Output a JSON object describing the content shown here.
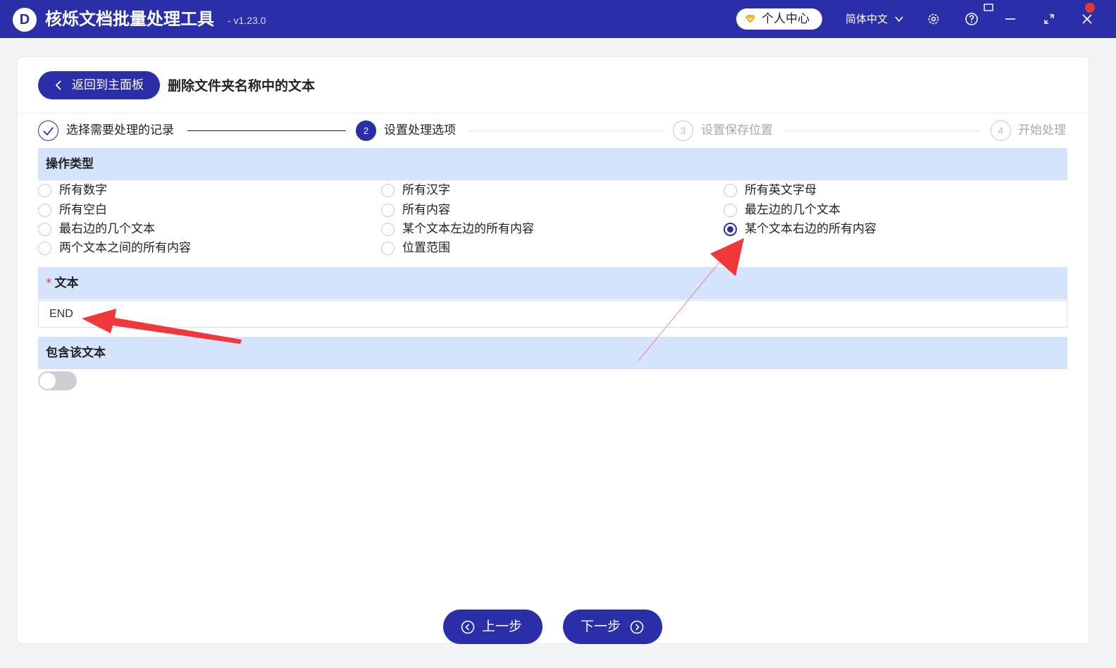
{
  "titlebar": {
    "logo_letter": "D",
    "title": "核烁文档批量处理工具",
    "version": "- v1.23.0",
    "user_center": "个人中心",
    "language": "简体中文",
    "icons": [
      "settings-icon",
      "help-icon",
      "minimize-icon",
      "maximize-icon",
      "close-icon"
    ]
  },
  "header": {
    "back_button": "返回到主面板",
    "page_title": "删除文件夹名称中的文本"
  },
  "steps": [
    {
      "number": "",
      "label": "选择需要处理的记录",
      "state": "done"
    },
    {
      "number": "2",
      "label": "设置处理选项",
      "state": "active"
    },
    {
      "number": "3",
      "label": "设置保存位置",
      "state": "pending"
    },
    {
      "number": "4",
      "label": "开始处理",
      "state": "pending"
    }
  ],
  "operation": {
    "title": "操作类型",
    "options": [
      {
        "label": "所有数字",
        "checked": false
      },
      {
        "label": "所有汉字",
        "checked": false
      },
      {
        "label": "所有英文字母",
        "checked": false
      },
      {
        "label": "所有空白",
        "checked": false
      },
      {
        "label": "所有内容",
        "checked": false
      },
      {
        "label": "最左边的几个文本",
        "checked": false
      },
      {
        "label": "最右边的几个文本",
        "checked": false
      },
      {
        "label": "某个文本左边的所有内容",
        "checked": false
      },
      {
        "label": "某个文本右边的所有内容",
        "checked": true
      },
      {
        "label": "两个文本之间的所有内容",
        "checked": false
      },
      {
        "label": "位置范围",
        "checked": false
      }
    ]
  },
  "text_field": {
    "required_mark": "*",
    "title": "文本",
    "value": "END"
  },
  "include_text": {
    "title": "包含该文本",
    "enabled": false
  },
  "footer": {
    "prev_label": "上一步",
    "next_label": "下一步"
  },
  "colors": {
    "primary": "#2a2ea8",
    "section_bg": "#d6e3fc",
    "annotation_arrow": "#f0383b"
  }
}
